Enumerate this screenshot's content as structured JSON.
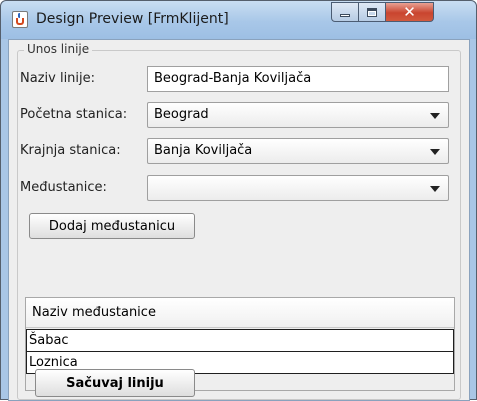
{
  "window": {
    "title": "Design Preview [FrmKlijent]",
    "close_glyph": "✕"
  },
  "form": {
    "group_title": "Unos linije",
    "naziv_label": "Naziv linije:",
    "naziv_value": "Beograd-Banja Koviljača",
    "pocetna_label": "Početna stanica:",
    "pocetna_value": "Beograd",
    "krajnja_label": "Krajnja stanica:",
    "krajnja_value": "Banja Koviljača",
    "medjustanice_label": "Međustanice:",
    "medjustanice_value": "",
    "add_button": "Dodaj međustanicu",
    "save_button": "Sačuvaj liniju"
  },
  "table": {
    "column_header": "Naziv međustanice",
    "rows": [
      "Šabac",
      "Loznica"
    ]
  }
}
